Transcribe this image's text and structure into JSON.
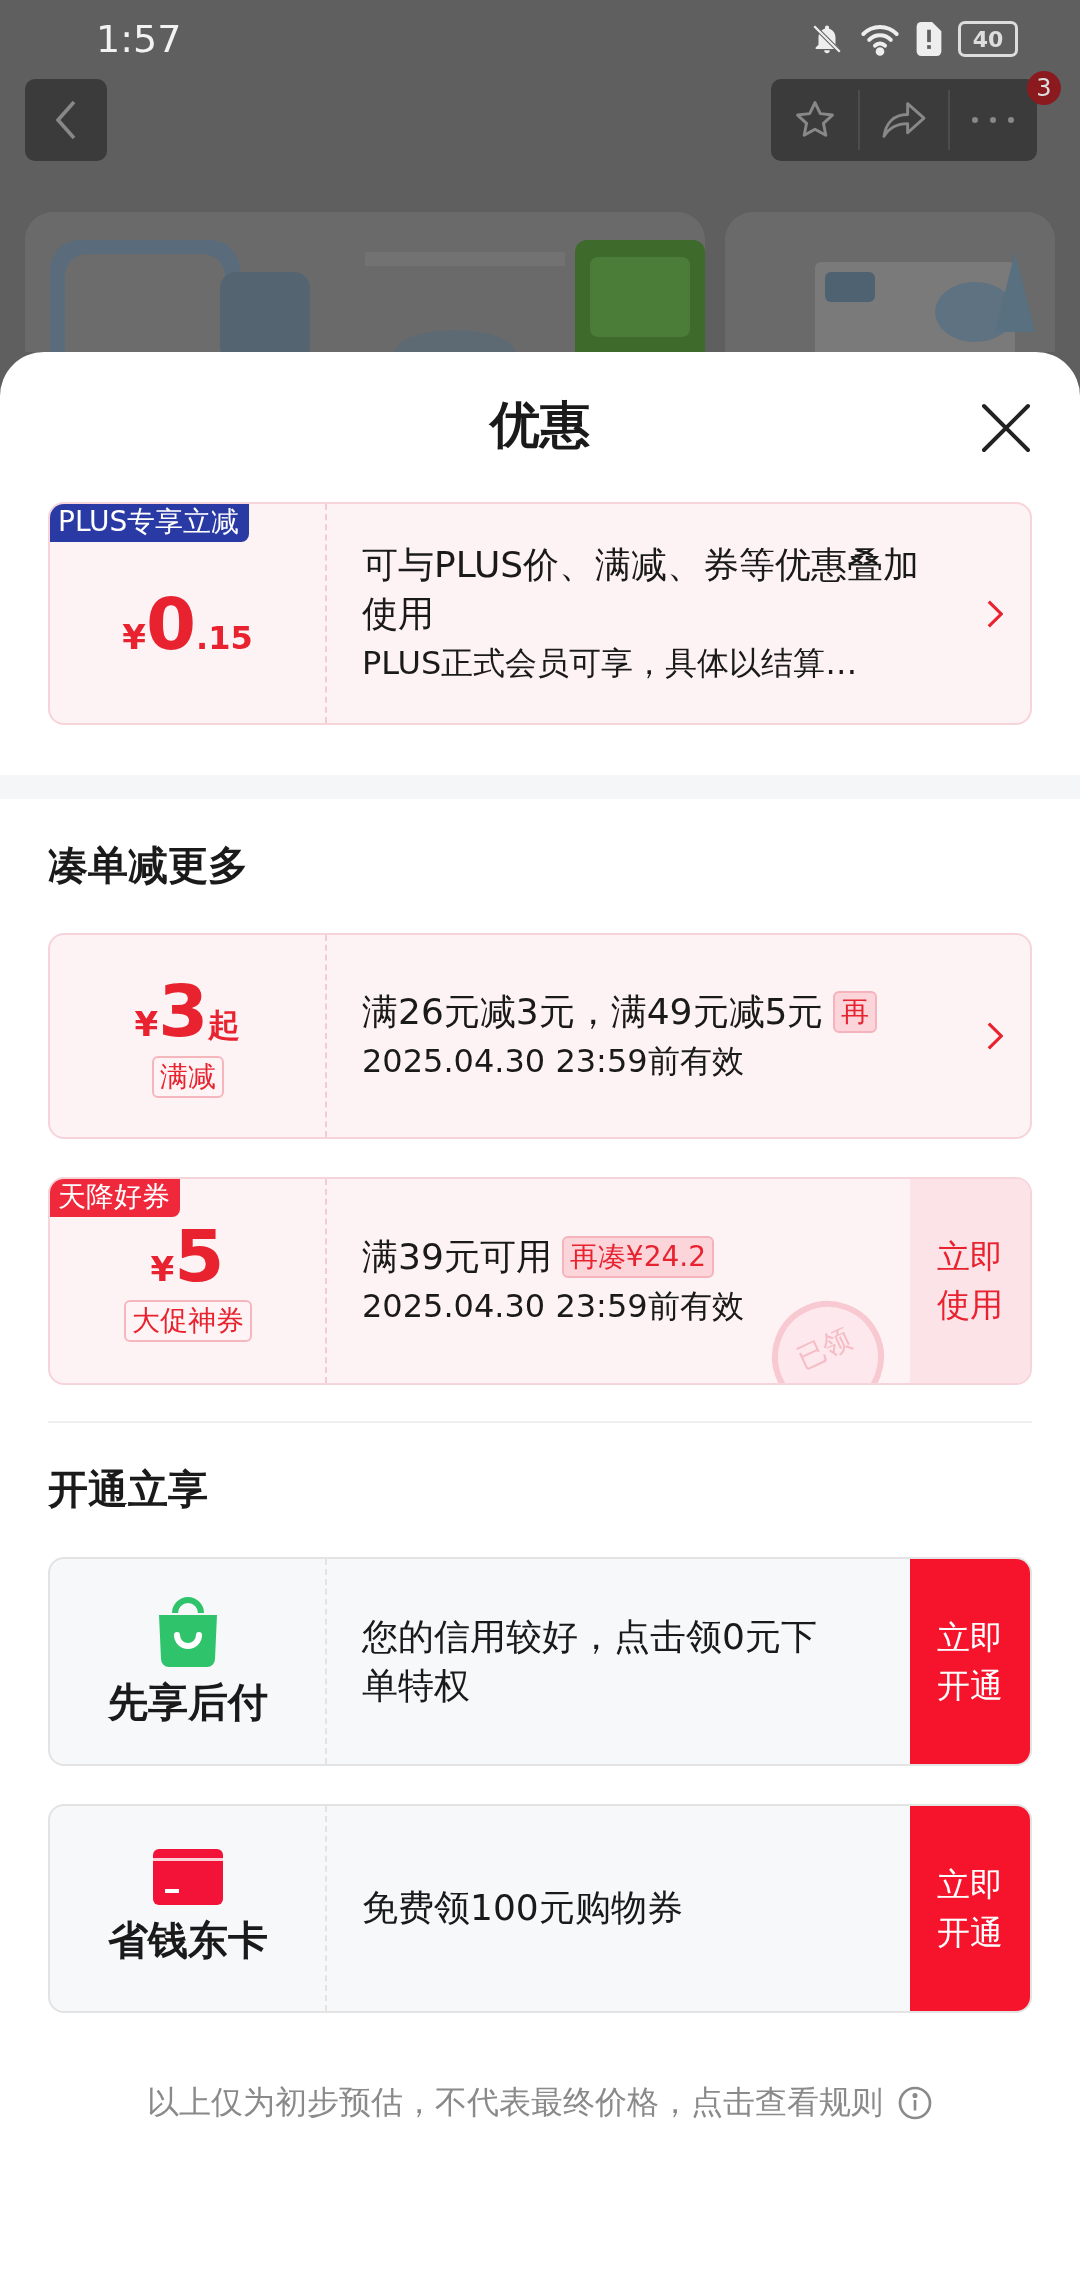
{
  "status_bar": {
    "time": "1:57",
    "battery": "40"
  },
  "nav": {
    "badge": "3"
  },
  "sheet": {
    "title": "优惠"
  },
  "plus_offer": {
    "tag": "PLUS专享立减",
    "currency": "¥",
    "amount": "0",
    "decimal": ".15",
    "title": "可与PLUS价、满减、券等优惠叠加使用",
    "subtitle": "PLUS正式会员可享，具体以结算…"
  },
  "coupon_section": {
    "title": "凑单减更多",
    "coupons": [
      {
        "kind": "link",
        "currency": "¥",
        "amount": "3",
        "suffix": "起",
        "label": "满减",
        "title": "满26元减3元，满49元减5元",
        "hint": "再",
        "validity": "2025.04.30 23:59前有效"
      },
      {
        "kind": "action",
        "corner_tag": "天降好券",
        "currency": "¥",
        "amount": "5",
        "label": "大促神券",
        "title": "满39元可用",
        "hint": "再凑¥24.2",
        "validity": "2025.04.30 23:59前有效",
        "action": "立即使用",
        "stamp": "已领"
      }
    ]
  },
  "service_section": {
    "title": "开通立享",
    "services": [
      {
        "kind": "bag",
        "name": "先享后付",
        "text": "您的信用较好，点击领0元下单特权",
        "action": "立即开通"
      },
      {
        "kind": "card",
        "name": "省钱东卡",
        "text": "免费领100元购物券",
        "action": "立即开通"
      }
    ]
  },
  "footer": {
    "note": "以上仅为初步预估，不代表最终价格，点击查看规则"
  }
}
